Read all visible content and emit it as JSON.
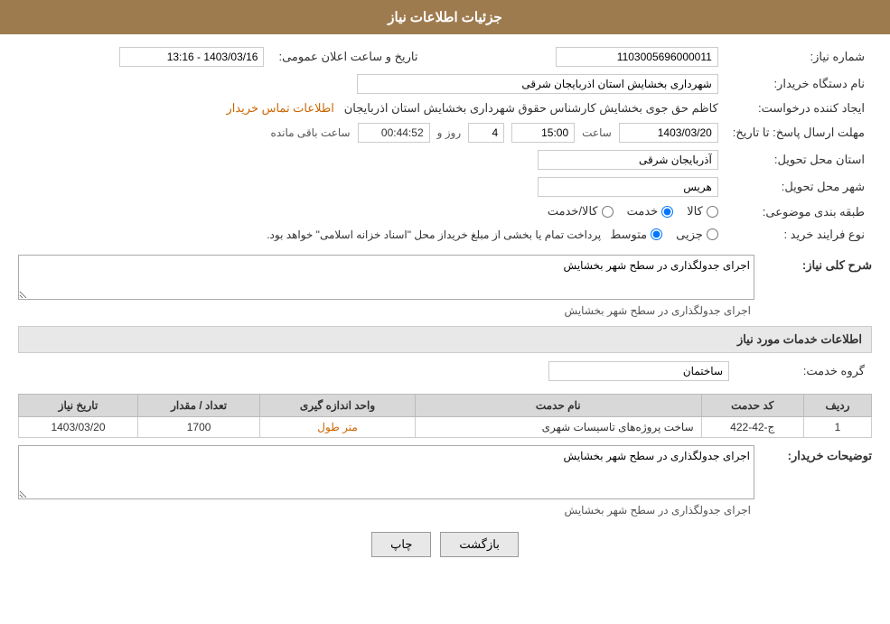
{
  "header": {
    "title": "جزئیات اطلاعات نیاز"
  },
  "fields": {
    "shomareNiaz_label": "شماره نیاز:",
    "shomareNiaz_value": "1103005696000011",
    "namDastgah_label": "نام دستگاه خریدار:",
    "namDastgah_value": "شهرداری بخشایش استان اذربایجان شرقی",
    "ijadKonande_label": "ایجاد کننده درخواست:",
    "ijadKonande_value": "کاظم حق جوی بخشایش کارشناس حقوق شهرداری بخشایش استان اذربایجان",
    "ijadKonande_link": "اطلاعات تماس خریدار",
    "mohlat_label": "مهلت ارسال پاسخ: تا تاریخ:",
    "mohlat_date": "1403/03/20",
    "mohlat_saat_label": "ساعت",
    "mohlat_saat": "15:00",
    "mohlat_roz_label": "روز و",
    "mohlat_roz": "4",
    "mohlat_countdown": "00:44:52",
    "mohlat_baqi": "ساعت باقی مانده",
    "tarikheElan_label": "تاریخ و ساعت اعلان عمومی:",
    "tarikheElan_value": "1403/03/16 - 13:16",
    "ostan_label": "استان محل تحویل:",
    "ostan_value": "آذربایجان شرقی",
    "shahr_label": "شهر محل تحویل:",
    "shahr_value": "هریس",
    "tabaqeBandi_label": "طبقه بندی موضوعی:",
    "tabaqe_options": [
      "کالا",
      "خدمت",
      "کالا/خدمت"
    ],
    "tabaqe_selected": "خدمت",
    "noeFarayand_label": "نوع فرایند خرید :",
    "noeFarayand_options": [
      "جزیی",
      "متوسط"
    ],
    "noeFarayand_selected": "متوسط",
    "noeFarayand_note": "پرداخت تمام یا بخشی از مبلغ خریداز محل \"اسناد خزانه اسلامی\" خواهد بود.",
    "sharhKoli_label": "شرح کلی نیاز:",
    "sharhKoli_value": "اجرای جدولگذاری در سطح شهر بخشایش",
    "khadamat_section": "اطلاعات خدمات مورد نیاز",
    "grohKhadamat_label": "گروه خدمت:",
    "grohKhadamat_value": "ساختمان",
    "table": {
      "headers": [
        "ردیف",
        "کد حدمت",
        "نام حدمت",
        "واحد اندازه گیری",
        "تعداد / مقدار",
        "تاریخ نیاز"
      ],
      "rows": [
        {
          "radif": "1",
          "kod": "ج-42-422",
          "nam": "ساخت پروژه‌های تاسیسات شهری",
          "vahed": "متر طول",
          "tedad": "1700",
          "tarikh": "1403/03/20"
        }
      ]
    },
    "tosaifKharidar_label": "توضیحات خریدار:",
    "tosaifKharidar_value": "اجرای جدولگذاری در سطح شهر بخشایش"
  },
  "buttons": {
    "chap": "چاپ",
    "bazgasht": "بازگشت"
  }
}
